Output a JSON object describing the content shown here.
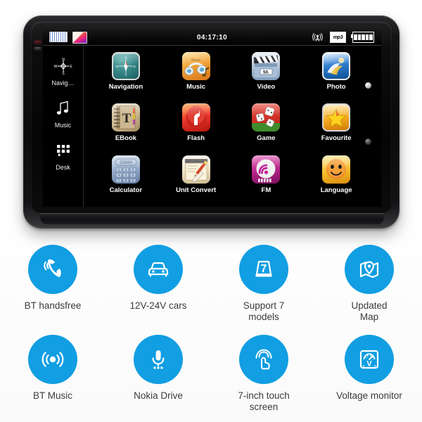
{
  "device": {
    "statusbar": {
      "clock": "04:17:10",
      "left_thumbs": [
        {
          "name": "grid-thumbnail",
          "kind": "grid"
        },
        {
          "name": "gradient-thumbnail",
          "kind": "gradient"
        }
      ],
      "signal_icon": "signal-tower-icon",
      "media_badge": "mp3",
      "battery_icon": "battery-icon",
      "battery_bars": 5
    },
    "sidebar": {
      "items": [
        {
          "label": "Navig…",
          "icon": "compass-icon"
        },
        {
          "label": "Music",
          "icon": "music-note-icon"
        },
        {
          "label": "Desk",
          "icon": "desk-grid-icon"
        }
      ]
    },
    "apps": [
      {
        "label": "Navigation",
        "icon": "compass-app-icon",
        "art": "ic-nav"
      },
      {
        "label": "Music",
        "icon": "headphones-app-icon",
        "art": "ic-music"
      },
      {
        "label": "Video",
        "icon": "clapperboard-app-icon",
        "art": "ic-video",
        "badge": "50."
      },
      {
        "label": "Photo",
        "icon": "photo-app-icon",
        "art": "ic-photo"
      },
      {
        "label": "EBook",
        "icon": "book-app-icon",
        "art": "ic-ebook",
        "badge": "T"
      },
      {
        "label": "Flash",
        "icon": "flash-app-icon",
        "art": "ic-flash",
        "badge": "f"
      },
      {
        "label": "Game",
        "icon": "dice-app-icon",
        "art": "ic-game"
      },
      {
        "label": "Favourite",
        "icon": "star-app-icon",
        "art": "ic-fav"
      },
      {
        "label": "Calculator",
        "icon": "calculator-app-icon",
        "art": "ic-calc",
        "badge": "25800"
      },
      {
        "label": "Unit Convert",
        "icon": "notepad-pencil-app-icon",
        "art": "ic-unit"
      },
      {
        "label": "FM",
        "icon": "radio-wave-app-icon",
        "art": "ic-fm"
      },
      {
        "label": "Language",
        "icon": "smiley-app-icon",
        "art": "ic-lang"
      }
    ],
    "sensors": [
      "indicator-light",
      "light-sensor"
    ]
  },
  "features": {
    "accent_color": "#119ee2",
    "items": [
      {
        "label": "BT handsfree",
        "icon": "phone-ringing-icon"
      },
      {
        "label": "12V-24V cars",
        "icon": "car-icon"
      },
      {
        "label": "Support 7\nmodels",
        "icon": "seven-models-icon"
      },
      {
        "label": "Updated\nMap",
        "icon": "map-pin-icon"
      },
      {
        "label": "BT Music",
        "icon": "broadcast-signal-icon"
      },
      {
        "label": "Nokia Drive",
        "icon": "microphone-icon"
      },
      {
        "label": "7-inch touch\nscreen",
        "icon": "touch-gesture-icon"
      },
      {
        "label": "Voltage monitor",
        "icon": "voltage-gauge-icon"
      }
    ]
  }
}
